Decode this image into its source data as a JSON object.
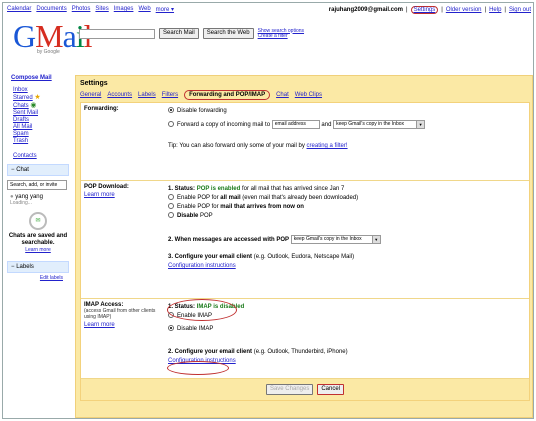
{
  "topnav": [
    "Calendar",
    "Documents",
    "Photos",
    "Sites",
    "Images",
    "Web",
    "more ▾"
  ],
  "topright": {
    "email": "rajuhang2009@gmail.com",
    "settings": "Settings",
    "older": "Older version",
    "help": "Help",
    "signout": "Sign out"
  },
  "logo": {
    "text": "Gmail",
    "beta": "by Google"
  },
  "search": {
    "search_mail": "Search Mail",
    "search_web": "Search the Web",
    "show_options": "Show search options",
    "create_filter": "Create a filter"
  },
  "sidebar": {
    "compose": "Compose Mail",
    "items": [
      "Inbox",
      "Starred",
      "Chats",
      "Sent Mail",
      "Drafts",
      "All Mail",
      "Spam",
      "Trash"
    ],
    "contacts": "Contacts",
    "chat_header": "Chat",
    "search_placeholder": "Search, add, or invite",
    "contact_name": "yang yang",
    "contact_status": "Loading...",
    "chat_saved": "Chats are saved and searchable.",
    "learn_more": "Learn more",
    "labels_header": "Labels",
    "edit_labels": "Edit labels"
  },
  "settings": {
    "title": "Settings",
    "tabs": [
      "General",
      "Accounts",
      "Labels",
      "Filters",
      "Forwarding and POP/IMAP",
      "Chat",
      "Web Clips"
    ],
    "forwarding": {
      "label": "Forwarding:",
      "disable": "Disable forwarding",
      "forward_prefix": "Forward a copy of incoming mail to",
      "address_value": "email address",
      "and": "and",
      "keep_option": "keep Gmail's copy in the Inbox",
      "tip_prefix": "Tip: You can also forward only some of your mail by",
      "tip_link": "creating a filter!"
    },
    "pop": {
      "label": "POP Download:",
      "learn": "Learn more",
      "status_prefix": "1. Status:",
      "status_value": "POP is enabled",
      "status_suffix": "for all mail that has arrived since Jan 7",
      "opt1_a": "Enable POP for",
      "opt1_b": "all mail",
      "opt1_c": "(even mail that's already been downloaded)",
      "opt2_a": "Enable POP for",
      "opt2_b": "mail that arrives from now on",
      "opt3_a": "Disable",
      "opt3_b": "POP",
      "when_label": "2. When messages are accessed with POP",
      "when_value": "keep Gmail's copy in the Inbox",
      "configure": "3. Configure your email client",
      "configure_rest": "(e.g. Outlook, Eudora, Netscape Mail)",
      "config_link": "Configuration instructions"
    },
    "imap": {
      "label": "IMAP Access:",
      "sub": "(access Gmail from other clients using IMAP)",
      "learn": "Learn more",
      "status_prefix": "1. Status:",
      "status_value": "IMAP is disabled",
      "enable": "Enable IMAP",
      "disable": "Disable IMAP",
      "configure": "2. Configure your email client",
      "configure_rest": "(e.g. Outlook, Thunderbird, iPhone)",
      "config_link": "Configuration instructions"
    },
    "buttons": {
      "save": "Save Changes",
      "cancel": "Cancel"
    }
  },
  "colors": {
    "accent_bg": "#fbe9a5",
    "link": "#2222cc",
    "annotation": "#c03030",
    "enabled": "#1a7a1a"
  }
}
